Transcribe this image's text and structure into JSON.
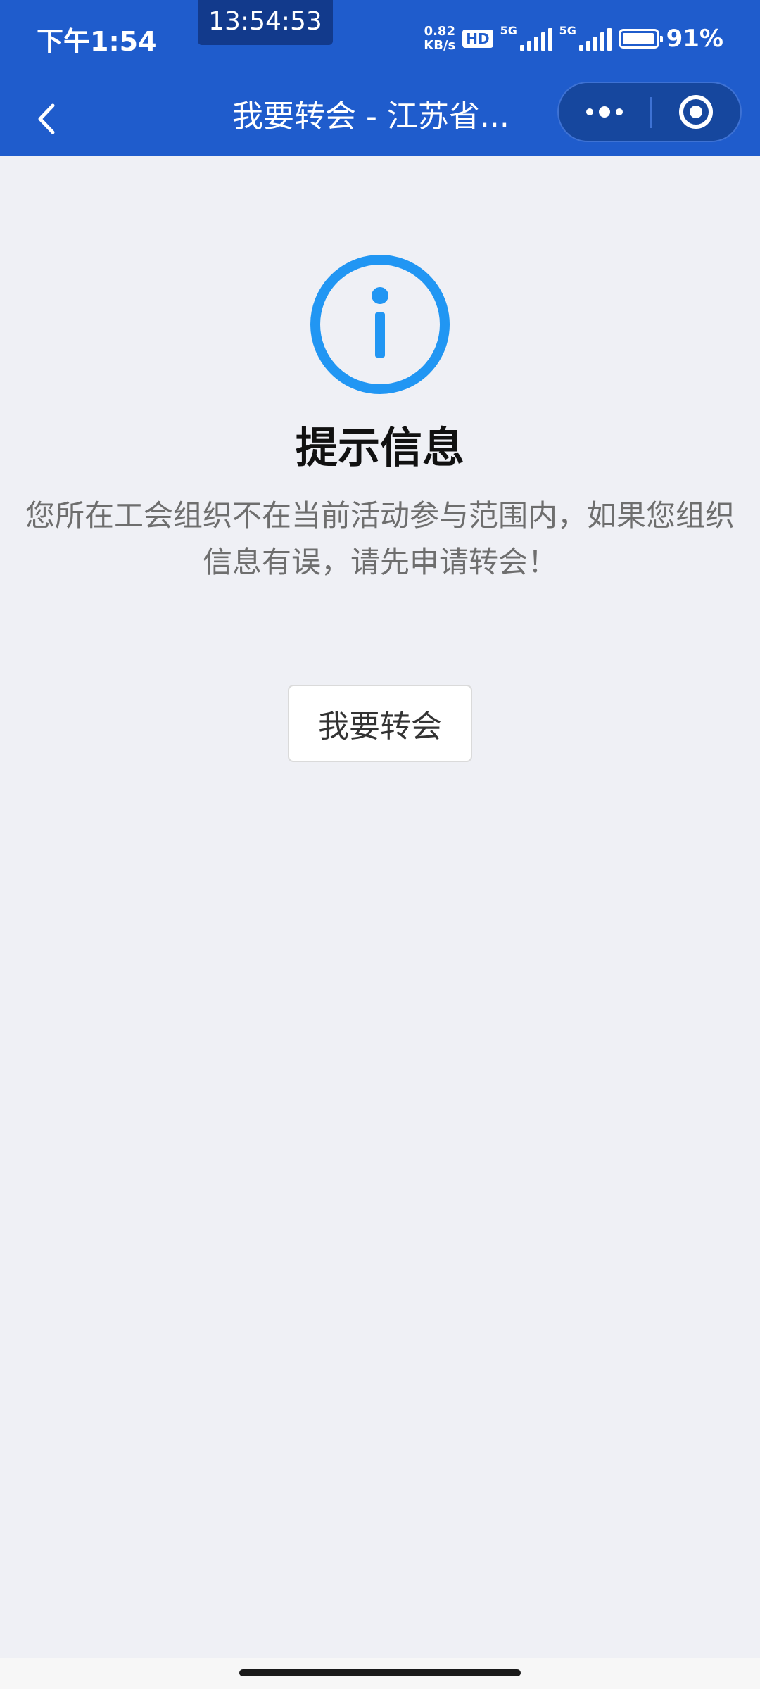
{
  "status_bar": {
    "time": "下午1:54",
    "clock_overlay": "13:54:53",
    "net_speed_value": "0.82",
    "net_speed_unit": "KB/s",
    "hd_label": "HD",
    "signal1_label": "5G",
    "signal2_label": "5G",
    "battery_percent": "91%"
  },
  "navbar": {
    "title": "我要转会 - 江苏省..."
  },
  "content": {
    "title": "提示信息",
    "message": "您所在工会组织不在当前活动参与范围内，如果您组织信息有误，请先申请转会！",
    "button_label": "我要转会"
  },
  "colors": {
    "header_blue": "#1f5ccc",
    "icon_blue": "#2196f3",
    "background": "#eff0f5"
  }
}
